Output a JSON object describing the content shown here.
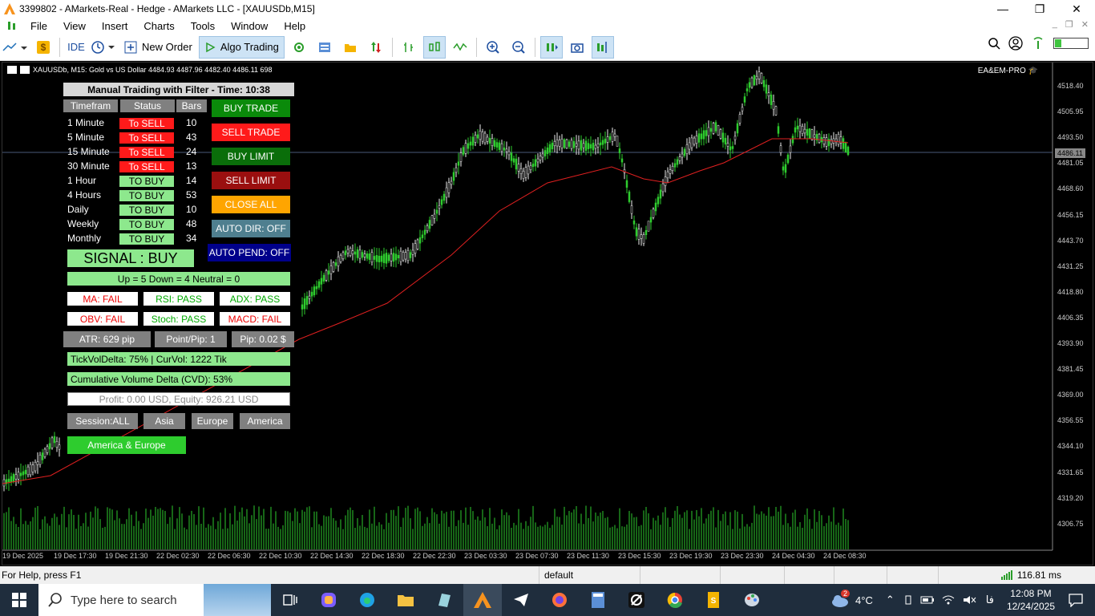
{
  "titlebar": {
    "title": "3399802 - AMarkets-Real - Hedge - AMarkets LLC - [XAUUSDb,M15]",
    "minimize": "—",
    "restore": "❐",
    "close": "✕"
  },
  "menu": {
    "items": [
      "File",
      "View",
      "Insert",
      "Charts",
      "Tools",
      "Window",
      "Help"
    ]
  },
  "toolbar": {
    "ide": "IDE",
    "new_order": "New Order",
    "algo_trading": "Algo Trading"
  },
  "chart": {
    "header": "XAUUSDb, M15:  Gold vs US Dollar  4484.93 4487.96 4482.40 4486.11  698",
    "ea_name": "EA&EM-PRO",
    "current_price": "4486.11",
    "y_ticks": [
      "4518.40",
      "4505.95",
      "4493.50",
      "4481.05",
      "4468.60",
      "4456.15",
      "4443.70",
      "4431.25",
      "4418.80",
      "4406.35",
      "4393.90",
      "4381.45",
      "4369.00",
      "4356.55",
      "4344.10",
      "4331.65",
      "4319.20",
      "4306.75"
    ],
    "x_ticks": [
      "19 Dec 2025",
      "19 Dec 17:30",
      "19 Dec 21:30",
      "22 Dec 02:30",
      "22 Dec 06:30",
      "22 Dec 10:30",
      "22 Dec 14:30",
      "22 Dec 18:30",
      "22 Dec 22:30",
      "23 Dec 03:30",
      "23 Dec 07:30",
      "23 Dec 11:30",
      "23 Dec 15:30",
      "23 Dec 19:30",
      "23 Dec 23:30",
      "24 Dec 04:30",
      "24 Dec 08:30"
    ]
  },
  "panel": {
    "title": "Manual Traiding with Filter  - Time: 10:38",
    "headers": [
      "Timefram",
      "Status",
      "Bars"
    ],
    "rows": [
      {
        "tf": "1 Minute",
        "status": "To SELL",
        "bars": "10"
      },
      {
        "tf": "5 Minute",
        "status": "To SELL",
        "bars": "43"
      },
      {
        "tf": "15 Minute",
        "status": "To SELL",
        "bars": "24"
      },
      {
        "tf": "30 Minute",
        "status": "To SELL",
        "bars": "13"
      },
      {
        "tf": "1 Hour",
        "status": "TO BUY",
        "bars": "14"
      },
      {
        "tf": "4 Hours",
        "status": "TO BUY",
        "bars": "53"
      },
      {
        "tf": "Daily",
        "status": "TO BUY",
        "bars": "10"
      },
      {
        "tf": "Weekly",
        "status": "TO BUY",
        "bars": "48"
      },
      {
        "tf": "Monthly",
        "status": "TO BUY",
        "bars": "34"
      }
    ],
    "buttons": {
      "buy_trade": "BUY TRADE",
      "sell_trade": "SELL TRADE",
      "buy_limit": "BUY LIMIT",
      "sell_limit": "SELL LIMIT",
      "close_all": "CLOSE ALL",
      "auto_dir": "AUTO DIR: OFF",
      "auto_pend": "AUTO PEND: OFF"
    },
    "signal": "SIGNAL : BUY",
    "summary": "Up = 5       Down = 4       Neutral = 0",
    "filters": [
      "MA: FAIL",
      "RSI: PASS",
      "ADX: PASS",
      "OBV: FAIL",
      "Stoch: PASS",
      "MACD: FAIL"
    ],
    "atr": "ATR: 629 pip",
    "point_pip": "Point/Pip: 1",
    "pip": "Pip: 0.02 $",
    "tickvol": "TickVolDelta: 75%   | CurVol: 1222 Tik",
    "cvd": "Cumulative Volume Delta (CVD):  53%",
    "profit": "Profit: 0.00 USD, Equity: 926.21 USD",
    "sessions": [
      "Session:ALL",
      "Asia",
      "Europe",
      "America"
    ],
    "america_europe": "America & Europe"
  },
  "statusbar": {
    "help": "For Help, press F1",
    "profile": "default",
    "ping": "116.81 ms"
  },
  "taskbar": {
    "search_placeholder": "Type here to search",
    "weather_badge": "2",
    "temp": "4°C",
    "lang": "فا",
    "time": "12:08 PM",
    "date": "12/24/2025"
  }
}
